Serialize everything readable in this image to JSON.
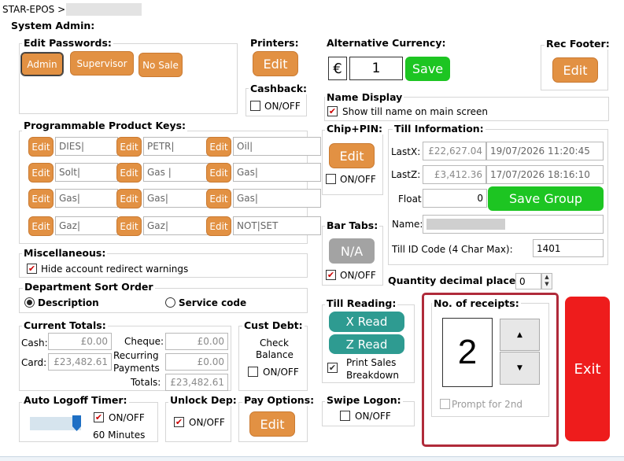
{
  "header": {
    "breadcrumb": "STAR-EPOS >"
  },
  "system_admin": {
    "title": "System Admin:"
  },
  "passwords": {
    "title": "Edit Passwords:",
    "buttons": [
      "Admin",
      "Supervisor",
      "No Sale"
    ]
  },
  "printers": {
    "title": "Printers:",
    "edit": "Edit"
  },
  "cashback": {
    "title": "Cashback:",
    "label": "ON/OFF",
    "checked": false
  },
  "alt_currency": {
    "title": "Alternative Currency:",
    "symbol": "€",
    "value": "1",
    "save": "Save"
  },
  "rec_footer": {
    "title": "Rec Footer:",
    "edit": "Edit"
  },
  "name_display": {
    "title": "Name Display",
    "label": "Show till name on main screen",
    "checked": true
  },
  "product_keys": {
    "title": "Programmable Product Keys:",
    "edit_label": "Edit",
    "rows": [
      [
        "DIES|",
        "PETR|",
        "Oil|"
      ],
      [
        "Solt|",
        "Gas |",
        "Gas|"
      ],
      [
        "Gas|",
        "Gas|",
        "Gas|"
      ],
      [
        "Gaz|",
        "Gaz|",
        "NOT|SET"
      ]
    ]
  },
  "chip_pin": {
    "title": "Chip+PIN:",
    "edit": "Edit",
    "label": "ON/OFF",
    "checked": false
  },
  "till_info": {
    "title": "Till Information:",
    "lastx_label": "LastX:",
    "lastx_value": "£22,627.04",
    "lastx_time": "19/07/2026 11:20:45",
    "lastz_label": "LastZ:",
    "lastz_value": "£3,412.36",
    "lastz_time": "17/07/2026 18:16:10",
    "float_label": "Float:",
    "float_value": "0",
    "save_group": "Save Group",
    "name_label": "Name:",
    "till_id_label": "Till ID Code (4 Char Max):",
    "till_id_value": "1401"
  },
  "misc": {
    "title": "Miscellaneous:",
    "label": "Hide account redirect warnings",
    "checked": true
  },
  "bar_tabs": {
    "title": "Bar Tabs:",
    "button": "N/A",
    "label": "ON/OFF",
    "checked": true
  },
  "dept_sort": {
    "title": "Department Sort Order",
    "option1": "Description",
    "option2": "Service code",
    "selected": "Description"
  },
  "qty_decimal": {
    "label": "Quantity decimal places:",
    "value": "0"
  },
  "totals": {
    "title": "Current Totals:",
    "cash_label": "Cash:",
    "cash_value": "£0.00",
    "card_label": "Card:",
    "card_value": "£23,482.61",
    "cheque_label": "Cheque:",
    "cheque_value": "£0.00",
    "recurring_label1": "Recurring",
    "recurring_label2": "Payments",
    "recurring_value": "£0.00",
    "totals_label": "Totals:",
    "totals_value": "£23,482.61"
  },
  "cust_debt": {
    "title": "Cust Debt:",
    "label1": "Check",
    "label2": "Balance",
    "onoff": "ON/OFF",
    "checked": false
  },
  "till_reading": {
    "title": "Till Reading:",
    "x_read": "X Read",
    "z_read": "Z Read",
    "print1": "Print Sales",
    "print2": "Breakdown",
    "checked": true
  },
  "receipts": {
    "title": "No. of receipts:",
    "value": "2",
    "prompt": "Prompt for 2nd",
    "up_icon": "triangle-up",
    "down_icon": "triangle-down"
  },
  "exit": {
    "label": "Exit",
    "color": "#ee1c1c"
  },
  "auto_logoff": {
    "title": "Auto Logoff Timer:",
    "onoff": "ON/OFF",
    "checked": true,
    "minutes": "60 Minutes",
    "slider_fraction": 1.0
  },
  "unlock_dep": {
    "title": "Unlock Dep:",
    "label": "ON/OFF",
    "checked": true
  },
  "pay_options": {
    "title": "Pay Options:",
    "edit": "Edit"
  },
  "swipe_logon": {
    "title": "Swipe Logon:",
    "label": "ON/OFF",
    "checked": false
  },
  "colors": {
    "accent_orange": "#e29143",
    "green": "#1dc522",
    "teal": "#2e9b91",
    "exit_red": "#ee1c1c",
    "highlight_border": "#b02a3a"
  }
}
